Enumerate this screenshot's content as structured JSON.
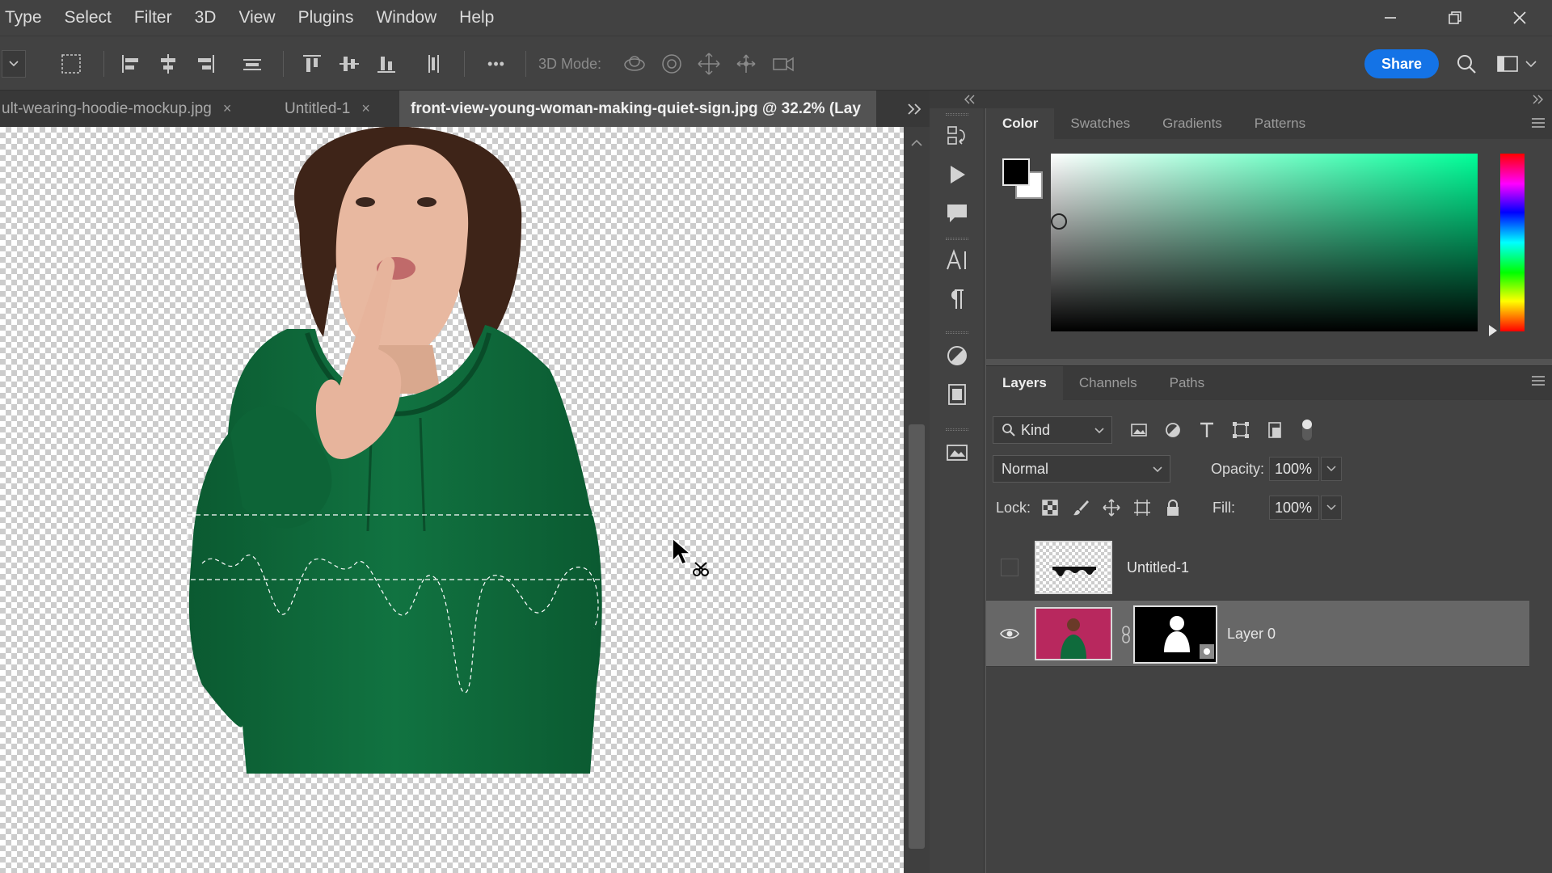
{
  "menu": [
    "Type",
    "Select",
    "Filter",
    "3D",
    "View",
    "Plugins",
    "Window",
    "Help"
  ],
  "options_bar": {
    "mode_label": "3D Mode:",
    "more_label": "•••",
    "share_label": "Share"
  },
  "tabs": [
    {
      "title": "ult-wearing-hoodie-mockup.jpg",
      "close": "×",
      "active": false
    },
    {
      "title": "Untitled-1",
      "close": "×",
      "active": false
    },
    {
      "title": "front-view-young-woman-making-quiet-sign.jpg @ 32.2% (Lay",
      "active": true
    }
  ],
  "color_panel": {
    "tabs": [
      "Color",
      "Swatches",
      "Gradients",
      "Patterns"
    ],
    "foreground": "#000000",
    "background": "#ffffff",
    "hue_color": "#00ff99"
  },
  "layers_panel": {
    "tabs": [
      "Layers",
      "Channels",
      "Paths"
    ],
    "filter_kind": "Kind",
    "blend_mode": "Normal",
    "opacity_label": "Opacity:",
    "opacity": "100%",
    "lock_label": "Lock:",
    "fill_label": "Fill:",
    "fill": "100%",
    "layers": [
      {
        "name": "Untitled-1",
        "visible": false,
        "selected": false
      },
      {
        "name": "Layer 0",
        "visible": true,
        "selected": true,
        "has_mask": true
      }
    ]
  },
  "colors": {
    "accent": "#1473e6",
    "hoodie": "#0f6b3c",
    "thumb_bg": "#b8285e"
  }
}
